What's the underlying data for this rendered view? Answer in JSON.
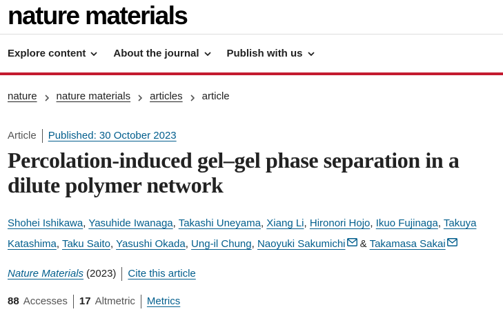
{
  "site": {
    "logo": "nature materials"
  },
  "nav": {
    "items": [
      {
        "label": "Explore content"
      },
      {
        "label": "About the journal"
      },
      {
        "label": "Publish with us"
      }
    ]
  },
  "breadcrumb": {
    "items": [
      "nature",
      "nature materials",
      "articles"
    ],
    "current": "article"
  },
  "article": {
    "type": "Article",
    "published": "Published: 30 October 2023",
    "title": "Percolation-induced gel–gel phase separation in a dilute polymer network",
    "authors": [
      "Shohei Ishikawa",
      "Yasuhide Iwanaga",
      "Takashi Uneyama",
      "Xiang Li",
      "Hironori Hojo",
      "Ikuo Fujinaga",
      "Takuya Katashima",
      "Taku Saito",
      "Yasushi Okada",
      "Ung-il Chung",
      "Naoyuki Sakumichi",
      "Takamasa Sakai"
    ],
    "authors_conjunction": "&",
    "journal_name": "Nature Materials",
    "journal_year": "(2023)",
    "cite_label": "Cite this article",
    "accesses_count": "88",
    "accesses_label": "Accesses",
    "altmetric_count": "17",
    "altmetric_label": "Altmetric",
    "metrics_label": "Metrics"
  },
  "colors": {
    "accent_red": "#c41a2f",
    "link_blue": "#025e8d"
  }
}
